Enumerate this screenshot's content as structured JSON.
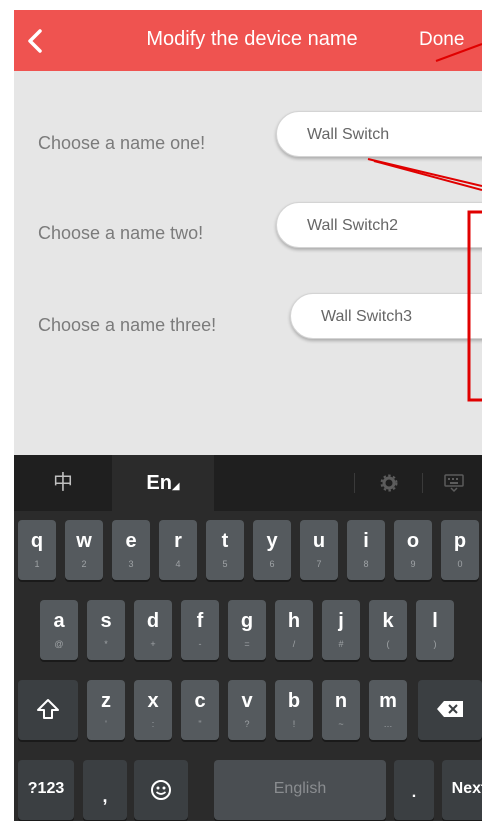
{
  "header": {
    "title": "Modify the device name",
    "done_label": "Done"
  },
  "rows": [
    {
      "label": "Choose a name one!",
      "value": "Wall Switch"
    },
    {
      "label": "Choose a name two!",
      "value": "Wall Switch2"
    },
    {
      "label": "Choose a name three!",
      "value": "Wall Switch3"
    }
  ],
  "keyboard": {
    "lang_chinese": "中",
    "lang_english": "En",
    "row1": [
      {
        "k": "q",
        "s": "1"
      },
      {
        "k": "w",
        "s": "2"
      },
      {
        "k": "e",
        "s": "3"
      },
      {
        "k": "r",
        "s": "4"
      },
      {
        "k": "t",
        "s": "5"
      },
      {
        "k": "y",
        "s": "6"
      },
      {
        "k": "u",
        "s": "7"
      },
      {
        "k": "i",
        "s": "8"
      },
      {
        "k": "o",
        "s": "9"
      },
      {
        "k": "p",
        "s": "0"
      }
    ],
    "row2": [
      {
        "k": "a",
        "s": "@"
      },
      {
        "k": "s",
        "s": "*"
      },
      {
        "k": "d",
        "s": "+"
      },
      {
        "k": "f",
        "s": "-"
      },
      {
        "k": "g",
        "s": "="
      },
      {
        "k": "h",
        "s": "/"
      },
      {
        "k": "j",
        "s": "#"
      },
      {
        "k": "k",
        "s": "("
      },
      {
        "k": "l",
        "s": ")"
      }
    ],
    "row3": [
      {
        "k": "z",
        "s": "'"
      },
      {
        "k": "x",
        "s": ":"
      },
      {
        "k": "c",
        "s": "\""
      },
      {
        "k": "v",
        "s": "?"
      },
      {
        "k": "b",
        "s": "!"
      },
      {
        "k": "n",
        "s": "~"
      },
      {
        "k": "m",
        "s": "…"
      }
    ],
    "sym_label": "?123",
    "comma": ",",
    "space_label": "English",
    "period": ".",
    "next_label": "Next"
  },
  "accent_color": "#ef5350",
  "annotation_color": "#e00000"
}
